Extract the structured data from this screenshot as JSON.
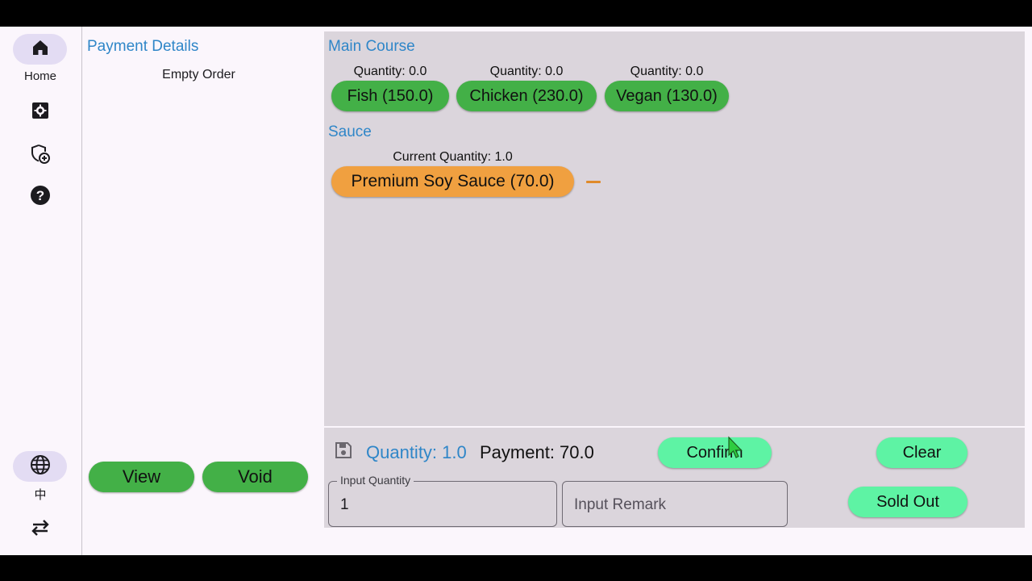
{
  "nav": {
    "home_label": "Home",
    "language_label": "中",
    "icons": [
      "home-icon",
      "settings-box-icon",
      "shield-add-icon",
      "help-icon",
      "globe-icon",
      "swap-icon"
    ]
  },
  "payment": {
    "title": "Payment Details",
    "empty_text": "Empty Order",
    "view_label": "View",
    "void_label": "Void"
  },
  "menu": {
    "main_course": {
      "title": "Main Course",
      "items": [
        {
          "quantity_label": "Quantity: 0.0",
          "label": "Fish (150.0)"
        },
        {
          "quantity_label": "Quantity: 0.0",
          "label": "Chicken (230.0)"
        },
        {
          "quantity_label": "Quantity: 0.0",
          "label": "Vegan (130.0)"
        }
      ]
    },
    "sauce": {
      "title": "Sauce",
      "items": [
        {
          "quantity_label": "Current Quantity: 1.0",
          "label": "Premium Soy Sauce (70.0)"
        }
      ]
    }
  },
  "bottom": {
    "quantity_status": "Quantity: 1.0",
    "payment_status": "Payment: 70.0",
    "confirm_label": "Confirm",
    "clear_label": "Clear",
    "sold_out_label": "Sold Out",
    "input_quantity_label": "Input Quantity",
    "input_quantity_value": "1",
    "input_remark_placeholder": "Input Remark"
  },
  "colors": {
    "accent_blue": "#2f86c8",
    "item_green": "#43b047",
    "selected_orange": "#f0a040",
    "action_mint": "#5ef3a4",
    "panel_gray": "#dbd5dc",
    "rail_pill": "#e3dcf3"
  }
}
